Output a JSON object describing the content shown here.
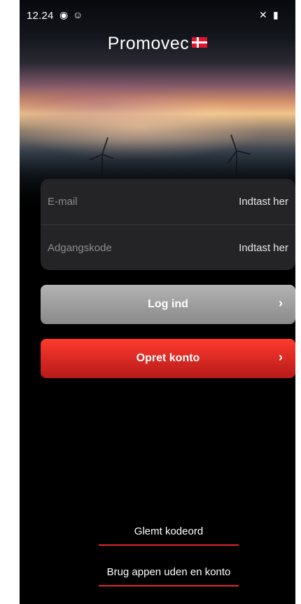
{
  "status_bar": {
    "time": "12.24",
    "icons": [
      "messenger-icon",
      "emoji-icon",
      "mute-icon",
      "signal-icon"
    ]
  },
  "brand": {
    "logo_text": "Promovec",
    "accent": "#e3152e"
  },
  "form": {
    "email": {
      "label": "E-mail",
      "value": "Indtast her"
    },
    "password": {
      "label": "Adgangskode",
      "value": "Indtast her"
    }
  },
  "buttons": {
    "login_label": "Log ind",
    "signup_label": "Opret konto",
    "chevron": "›"
  },
  "links": {
    "forgot_password": "Glemt kodeord",
    "use_without_account": "Brug appen uden en konto"
  }
}
